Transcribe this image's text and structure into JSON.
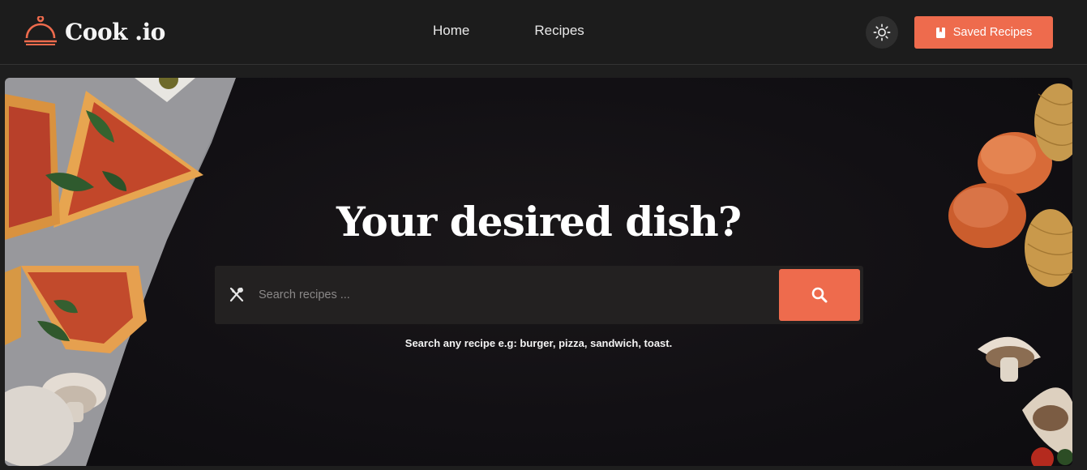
{
  "header": {
    "logo_text": "Cook .io",
    "nav": [
      {
        "label": "Home"
      },
      {
        "label": "Recipes"
      }
    ],
    "saved_label": "Saved Recipes",
    "theme_icon": "sun-icon",
    "saved_icon": "bookmark-icon",
    "logo_icon": "cloche-icon"
  },
  "hero": {
    "title": "Your desired dish?",
    "search_placeholder": "Search recipes ...",
    "search_value": "",
    "hint": "Search any recipe e.g: burger, pizza, sandwich, toast.",
    "left_icon": "fork-knife-icon",
    "button_icon": "search-icon"
  },
  "colors": {
    "accent": "#ee6b4d",
    "background": "#1e1e1e",
    "hero_background": "#121014",
    "search_bar": "#232121"
  }
}
